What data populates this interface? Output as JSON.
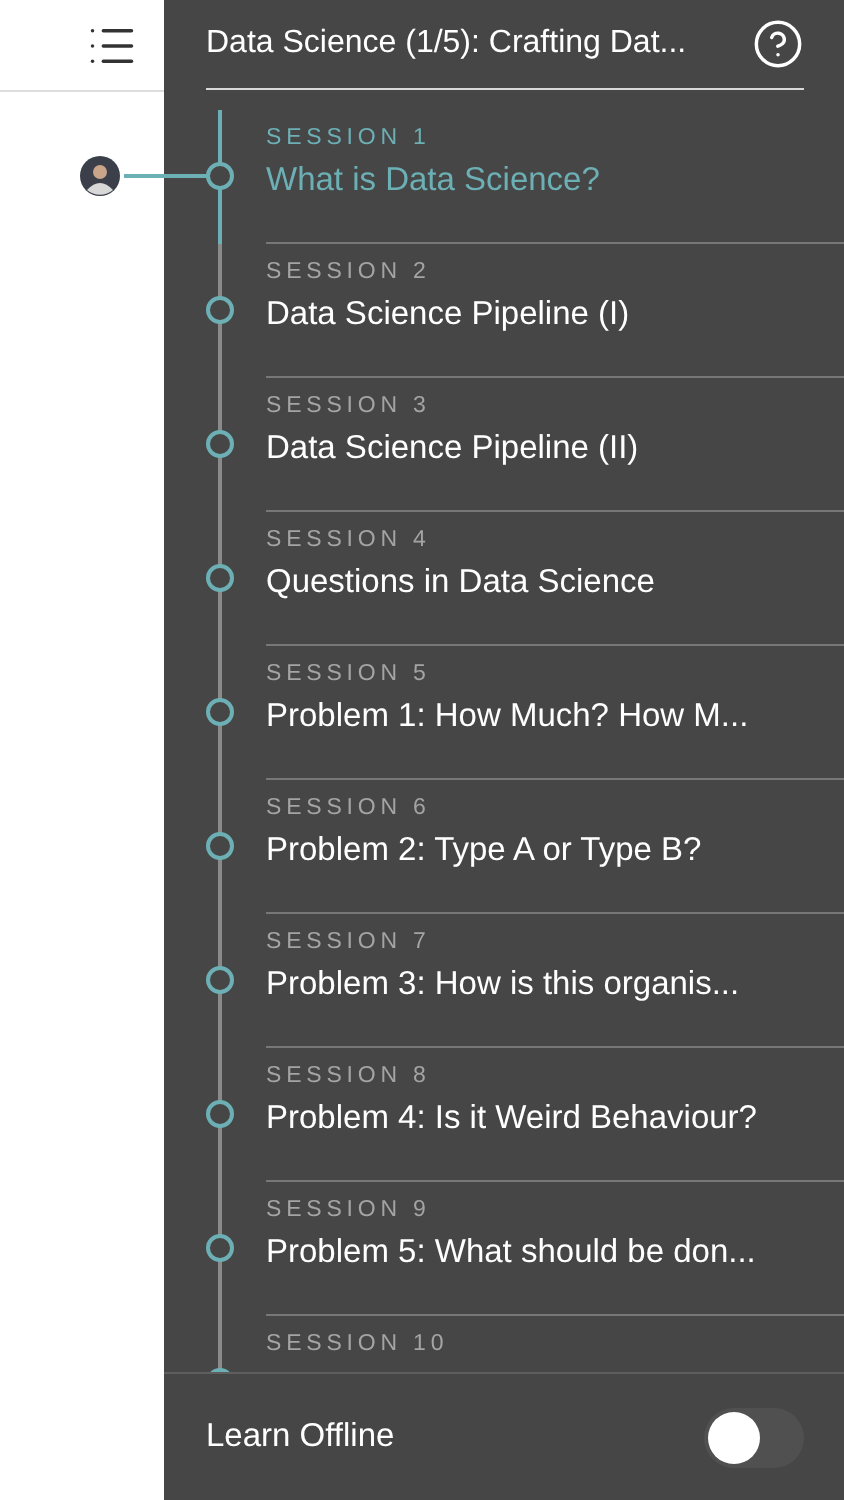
{
  "header": {
    "title": "Data Science (1/5): Crafting Dat..."
  },
  "sessions": [
    {
      "label": "SESSION 1",
      "title": "What is Data Science?",
      "selected": true
    },
    {
      "label": "SESSION 2",
      "title": "Data Science Pipeline (I)",
      "selected": false
    },
    {
      "label": "SESSION 3",
      "title": "Data Science Pipeline (II)",
      "selected": false
    },
    {
      "label": "SESSION 4",
      "title": "Questions in Data Science",
      "selected": false
    },
    {
      "label": "SESSION 5",
      "title": "Problem 1: How Much? How M...",
      "selected": false
    },
    {
      "label": "SESSION 6",
      "title": "Problem 2: Type A or Type B?",
      "selected": false
    },
    {
      "label": "SESSION 7",
      "title": "Problem 3: How is this organis...",
      "selected": false
    },
    {
      "label": "SESSION 8",
      "title": "Problem 4: Is it Weird Behaviour?",
      "selected": false
    },
    {
      "label": "SESSION 9",
      "title": "Problem 5: What should be don...",
      "selected": false
    },
    {
      "label": "SESSION 10",
      "selected": false
    }
  ],
  "offline": {
    "label": "Learn Offline",
    "on": false
  }
}
